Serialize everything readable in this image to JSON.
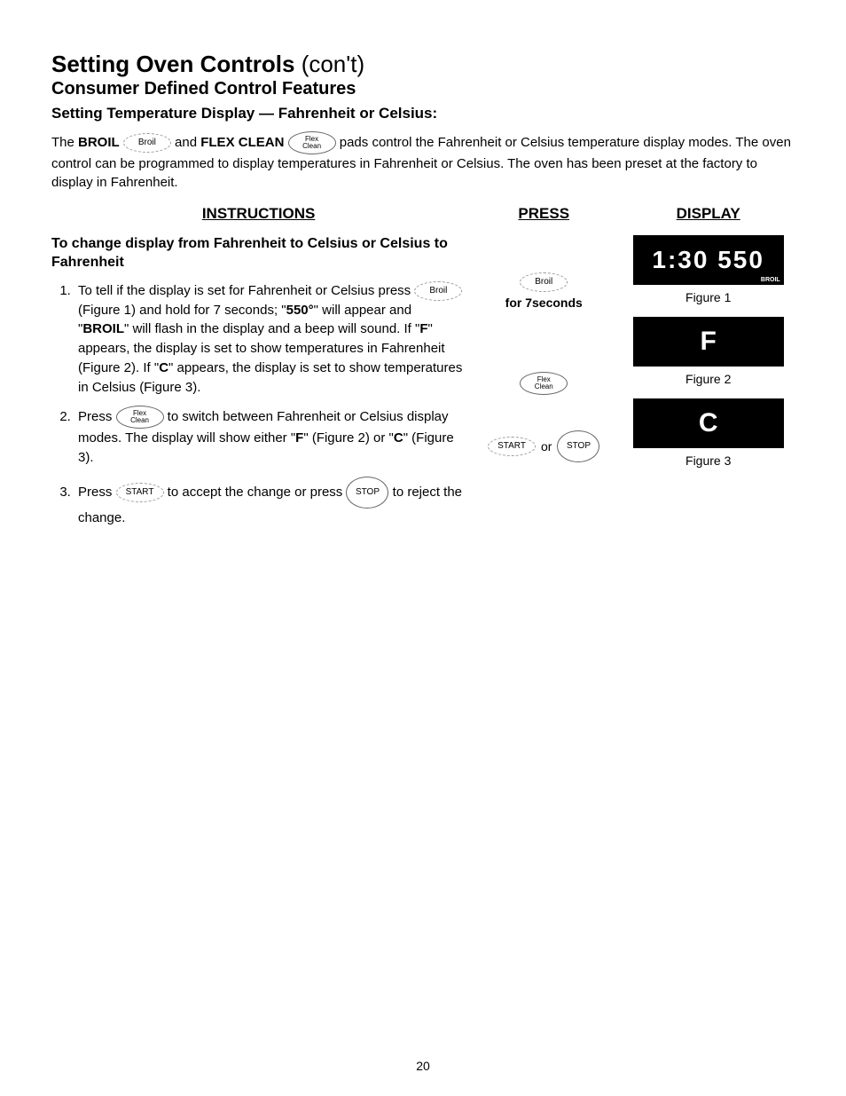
{
  "title": {
    "main_bold": "Setting Oven Controls",
    "main_rest": " (con't)",
    "sub": "Consumer Defined Control Features",
    "subsub": "Setting Temperature Display — Fahrenheit or Celsius:"
  },
  "intro": {
    "t1": "The ",
    "b1": "BROIL",
    "t2": " ",
    "pad1": "Broil",
    "t3": " and ",
    "b2": "FLEX CLEAN",
    "t4": " ",
    "pad2a": "Flex",
    "pad2b": "Clean",
    "t5": " pads control the Fahrenheit or Celsius temperature display modes. The oven control can be programmed to display temperatures in Fahrenheit or Celsius. The oven has been preset at the factory to display in Fahrenheit."
  },
  "headers": {
    "instructions": "INSTRUCTIONS",
    "press": "PRESS",
    "display": "DISPLAY"
  },
  "change_heading": "To change display from Fahrenheit to Celsius or Celsius to Fahrenheit",
  "steps": {
    "s1": {
      "a": "To tell if the display is set for Fahrenheit or Celsius press ",
      "pad": "Broil",
      "b": " (Figure 1) and hold for 7 seconds; \"",
      "bold1": "550°",
      "c": "\" will appear and \"",
      "bold2": "BROIL",
      "d": "\" will flash in the display and a beep will sound. If \"",
      "bold3": "F",
      "e": "\" appears, the display is set to show temperatures in Fahrenheit (Figure 2). If \"",
      "bold4": "C",
      "f": "\" appears, the display is set to show temperatures in Celsius (Figure 3)."
    },
    "s2": {
      "a": "Press ",
      "pad_a": "Flex",
      "pad_b": "Clean",
      "b": " to switch between Fahrenheit or Celsius display modes. The display will show either \"",
      "bold1": "F",
      "c": "\" (Figure 2) or \"",
      "bold2": "C",
      "d": "\" (Figure 3)."
    },
    "s3": {
      "a": "Press ",
      "pad1": "START",
      "b": " to accept the change or press ",
      "pad2": "STOP",
      "c": " to reject the change."
    }
  },
  "press": {
    "p1_label": "Broil",
    "p1_caption": "for 7seconds",
    "p2_a": "Flex",
    "p2_b": "Clean",
    "p3_a": "START",
    "p3_or": "or",
    "p3_b": "STOP"
  },
  "display": {
    "fig1_text": "1:30 550",
    "fig1_small": "BROIL",
    "fig1_cap": "Figure 1",
    "fig2_text": "F",
    "fig2_cap": "Figure 2",
    "fig3_text": "C",
    "fig3_cap": "Figure 3"
  },
  "page_number": "20"
}
